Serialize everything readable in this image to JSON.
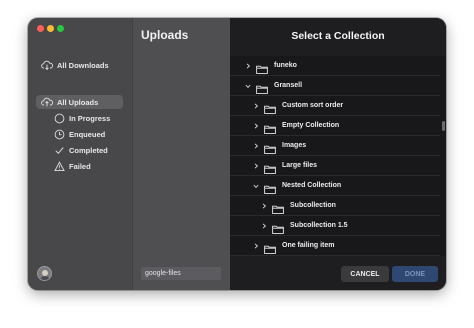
{
  "sidebar": {
    "all_downloads": "All Downloads",
    "all_uploads": "All Uploads",
    "in_progress": "In Progress",
    "enqueued": "Enqueued",
    "completed": "Completed",
    "failed": "Failed"
  },
  "middle": {
    "title": "Uploads",
    "field_value": "google-files"
  },
  "modal": {
    "title": "Select a Collection",
    "items": [
      {
        "label": "funeko",
        "expanded": false
      },
      {
        "label": "Gransell",
        "expanded": true
      },
      {
        "label": "Custom sort order",
        "expanded": false
      },
      {
        "label": "Empty Collection",
        "expanded": false
      },
      {
        "label": "Images",
        "expanded": false
      },
      {
        "label": "Large files",
        "expanded": false
      },
      {
        "label": "Nested Collection",
        "expanded": true
      },
      {
        "label": "Subcollection",
        "expanded": false
      },
      {
        "label": "Subcollection 1.5",
        "expanded": false
      },
      {
        "label": "One failing item",
        "expanded": false
      }
    ],
    "cancel_label": "CANCEL",
    "done_label": "DONE"
  }
}
